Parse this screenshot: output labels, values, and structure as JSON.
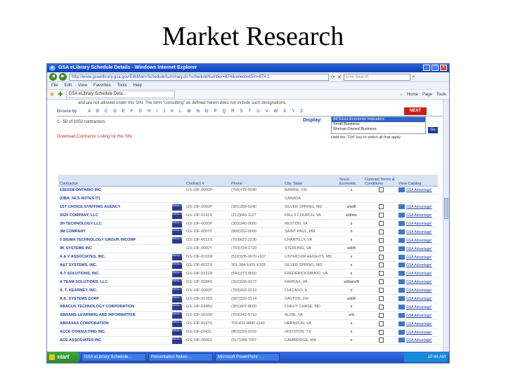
{
  "slide": {
    "title": "Market Research"
  },
  "window": {
    "title": "GSA eLibrary Schedule Details - Windows Internet Explorer",
    "address": "http://www.gsaelibrary.gsa.gov/ElibMain/ScheduleSummary.do?scheduleNumber=874&selectedSin=874 1",
    "search_placeholder": "Live Search",
    "menu": [
      "File",
      "Edit",
      "View",
      "Favorites",
      "Tools",
      "Help"
    ],
    "tab_title": "GSA eLibrary Schedule Deta...",
    "toolbar": {
      "home": "Home",
      "page": "Page",
      "tools": "Tools"
    }
  },
  "page": {
    "notice": "and are not allowed under this SIN. The term \"consulting\" as defined herein does not include such designations.",
    "browse_label": "Browse by:",
    "letters": [
      "A",
      "B",
      "C",
      "D",
      "E",
      "F",
      "G",
      "H",
      "I",
      "J",
      "K",
      "L",
      "M",
      "N",
      "O",
      "P",
      "Q",
      "R",
      "S",
      "T",
      "U",
      "V",
      "W",
      "X",
      "Y",
      "Z"
    ],
    "next_label": "NEXT",
    "range_text": "1 - 50 of 1002 contractors",
    "breadcrumb": "Download Contractor Listing for this SIN",
    "display_label": "Display:",
    "display_options": [
      "All Socio-Economic Indicators",
      "Small Business",
      "Woman Owned Business"
    ],
    "go_label": "Go",
    "hold_tip": "Hold the \"Ctrl\" key to select all that apply",
    "headers": {
      "contractor": "Contractor",
      "contract": "Contract #",
      "phone": "Phone",
      "city_state": "City, State",
      "socio": "Socio-Economic",
      "terms": "Contract Terms & Conditions",
      "catalog": "View Catalog"
    },
    "catalog_link": "GSA Advantage!",
    "rows": [
      {
        "contractor": "1SESSE ONTARIO INC",
        "logo": "",
        "contract": "GS-10F-0000P",
        "phone": "(705)722-5590",
        "city": "BARRIE, ON",
        "socio": "s"
      },
      {
        "contractor": "(DBA: NCS NOTES IT)",
        "logo": "",
        "contract": "",
        "phone": "",
        "city": "CANADA",
        "socio": ""
      },
      {
        "contractor": "1ST CHOICE STAFFING AGENCY",
        "logo": "SMALL BUSINESS",
        "contract": "GS-10F-0000P",
        "phone": "(301)355-5040",
        "city": "SILVER SPRING, MD",
        "socio": "s/w/8"
      },
      {
        "contractor": "2020 COMPANY, LLC",
        "logo": "SMALL BUSINESS",
        "contract": "GS-10F-0141S",
        "phone": "(212)845-1127",
        "city": "FALLS CHURCH, VA",
        "socio": "s/d/wo"
      },
      {
        "contractor": "3H TECHNOLOGY LLC",
        "logo": "SMALL BUSINESS",
        "contract": "GS-10F-0000P",
        "phone": "(303)340-0000",
        "city": "RESTON, VA",
        "socio": "s"
      },
      {
        "contractor": "3M COMPANY",
        "logo": "SMALL BUSINESS",
        "contract": "GS-10F-0007P",
        "phone": "(800)332-0000",
        "city": "SAINT PAUL, MN",
        "socio": "o"
      },
      {
        "contractor": "5 SIGMA TECHNOLOGY GROUP, INCORP",
        "logo": "SMALL BUSINESS",
        "contract": "GS-10F-0012S",
        "phone": "(703)627-2230",
        "city": "CHANTILLY, VA",
        "socio": "s"
      },
      {
        "contractor": "9K SYSTEMS INC",
        "logo": "",
        "contract": "GS-10F-0000Y",
        "phone": "(703)724-1720",
        "city": "STERLING, VA",
        "socio": "s/d/8"
      },
      {
        "contractor": "A & V ASSOCIATES, INC.",
        "logo": "SMALL BUSINESS",
        "contract": "GS-10F-0102R",
        "phone": "(516)935-0070 x107",
        "city": "LINTHICUM HEIGHTS, MD",
        "socio": "s"
      },
      {
        "contractor": "A&T SYSTEMS, INC.",
        "logo": "SMALL BUSINESS",
        "contract": "GS-10F-0022S",
        "phone": "301-384-1425 X269",
        "city": "SILVER SPRING, MD",
        "socio": "s"
      },
      {
        "contractor": "A-T SOLUTIONS, INC.",
        "logo": "SMALL BUSINESS",
        "contract": "GS-10F-0321R",
        "phone": "(540)373-9500",
        "city": "FREDERICKSBURG, VA",
        "socio": "s"
      },
      {
        "contractor": "A TEAM SOLUTIONS, LLC",
        "logo": "SMALL BUSINESS",
        "contract": "GS-10F-0084S",
        "phone": "(202)536-9172",
        "city": "FAIRFAX, VA",
        "socio": "s/d/w/v/8"
      },
      {
        "contractor": "A. T. KEARNEY, INC.",
        "logo": "SMALL BUSINESS",
        "contract": "GS-10F-0000P",
        "phone": "(703)302-0210",
        "city": "CHICAGO, IL",
        "socio": "o"
      },
      {
        "contractor": "A.K. SYSTEMS CORP",
        "logo": "SMALL BUSINESS",
        "contract": "GS-10F-0178S",
        "phone": "(937)320-0174",
        "city": "DAYTON, OH",
        "socio": "s/d/8"
      },
      {
        "contractor": "ABACUS TECHNOLOGY CORPORATION",
        "logo": "SMALL BUSINESS",
        "contract": "GS-10F-0348U",
        "phone": "(301)907-8500",
        "city": "CHEVY CHASE, MD",
        "socio": "s"
      },
      {
        "contractor": "ABRAMS LEARNING AND INFORMATION",
        "logo": "SMALL BUSINESS",
        "contract": "GS-10F-0010R",
        "phone": "(703)742-5710",
        "city": "ALDIE, VA",
        "socio": "s/d"
      },
      {
        "contractor": "ABRAXAS CORPORATION",
        "logo": "SMALL BUSINESS",
        "contract": "GS-10F-0157S",
        "phone": "703-821-8880 x240",
        "city": "HERNDON, VA",
        "socio": "s"
      },
      {
        "contractor": "ACCE CONSULTING INC.",
        "logo": "SMALL BUSINESS",
        "contract": "GS-10F-0042L",
        "phone": "(863)293-0232",
        "city": "HOUSTON, TX",
        "socio": "s"
      },
      {
        "contractor": "ACE ASSOCIATES INC",
        "logo": "SMALL BUSINESS",
        "contract": "GS-10F-0000X",
        "phone": "(617)349-7057",
        "city": "CAMBRIDGE, MA",
        "socio": "s"
      }
    ]
  },
  "taskbar": {
    "start_label": "start",
    "tasks": [
      "GSA eLibrary Schedule...",
      "Presentation Notes-...",
      "Microsoft PowerPoint -..."
    ],
    "clock": "10:44 AM"
  }
}
